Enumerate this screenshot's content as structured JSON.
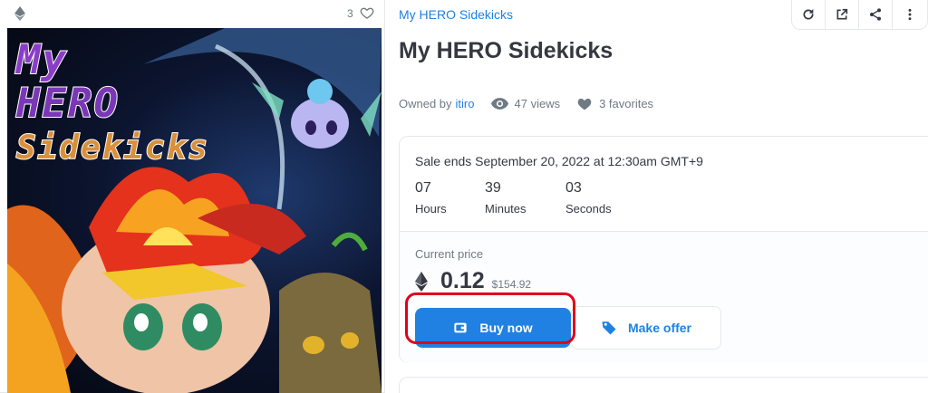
{
  "media": {
    "favorite_count": "3",
    "chain_icon": "ethereum-icon",
    "favorite_icon": "heart-outline-icon",
    "artwork_text": [
      "My",
      "HERO",
      "Sidekicks"
    ]
  },
  "header": {
    "collection_name": "My HERO Sidekicks",
    "toolbar_icons": [
      "refresh-icon",
      "external-link-icon",
      "share-icon",
      "more-icon"
    ]
  },
  "item": {
    "title": "My HERO Sidekicks",
    "owned_by_label": "Owned by",
    "owner": "itiro",
    "views": "47 views",
    "favorites": "3 favorites"
  },
  "sale": {
    "ends_text": "Sale ends September 20, 2022 at 12:30am GMT+9",
    "countdown": [
      {
        "value": "07",
        "label": "Hours"
      },
      {
        "value": "39",
        "label": "Minutes"
      },
      {
        "value": "03",
        "label": "Seconds"
      }
    ],
    "current_price_label": "Current price",
    "price_eth": "0.12",
    "price_usd": "$154.92",
    "buy_label": "Buy now",
    "offer_label": "Make offer"
  },
  "colors": {
    "accent": "#2081e2",
    "highlight": "#e0001a",
    "text": "#353840",
    "muted": "#707a83"
  }
}
